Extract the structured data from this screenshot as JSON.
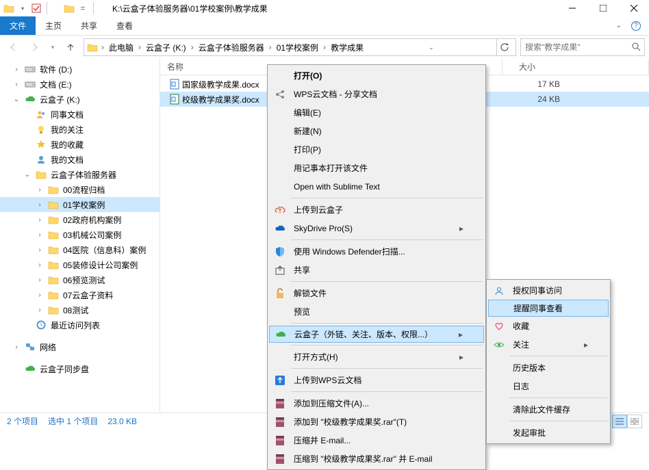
{
  "window": {
    "title": "K:\\云盒子体验服务器\\01学校案例\\教学成果"
  },
  "ribbon": {
    "file": "文件",
    "tabs": [
      "主页",
      "共享",
      "查看"
    ]
  },
  "nav": {
    "crumbs": [
      "此电脑",
      "云盒子 (K:)",
      "云盒子体验服务器",
      "01学校案例",
      "教学成果"
    ],
    "search_placeholder": "搜索\"教学成果\""
  },
  "tree": {
    "top": [
      {
        "label": "软件 (D:)",
        "icon": "drive"
      },
      {
        "label": "文档 (E:)",
        "icon": "drive"
      },
      {
        "label": "云盒子 (K:)",
        "icon": "cloud",
        "open": true
      }
    ],
    "cloud_children": [
      {
        "label": "同事文档",
        "icon": "people"
      },
      {
        "label": "我的关注",
        "icon": "bulb"
      },
      {
        "label": "我的收藏",
        "icon": "star"
      },
      {
        "label": "我的文档",
        "icon": "user"
      },
      {
        "label": "云盒子体验服务器",
        "icon": "folder",
        "open": true
      }
    ],
    "server_children": [
      {
        "label": "00流程归档"
      },
      {
        "label": "01学校案例",
        "sel": true
      },
      {
        "label": "02政府机构案例"
      },
      {
        "label": "03机械公司案例"
      },
      {
        "label": "04医院（信息科）案例"
      },
      {
        "label": "05装修设计公司案例"
      },
      {
        "label": "06预览测试"
      },
      {
        "label": "07云盒子资料"
      },
      {
        "label": "08测试"
      }
    ],
    "recent": "最近访问列表",
    "network": "网络",
    "syncdisk": "云盒子同步盘"
  },
  "columns": {
    "name": "名称",
    "size": "大小"
  },
  "files": [
    {
      "name": "国家级教学成果.docx",
      "size": "17 KB",
      "sel": false,
      "type": "word"
    },
    {
      "name": "校级教学成果奖.docx",
      "size": "24 KB",
      "sel": true,
      "type": "excel"
    }
  ],
  "context_menu": [
    {
      "label": "打开(O)",
      "bold": true
    },
    {
      "label": "WPS云文档 - 分享文档",
      "icon": "share"
    },
    {
      "label": "编辑(E)"
    },
    {
      "label": "新建(N)"
    },
    {
      "label": "打印(P)"
    },
    {
      "label": "用记事本打开该文件"
    },
    {
      "label": "Open with Sublime Text"
    },
    {
      "sep": true
    },
    {
      "label": "上传到云盒子",
      "icon": "upload-cloud"
    },
    {
      "label": "SkyDrive Pro(S)",
      "icon": "skydrive",
      "arrow": true
    },
    {
      "sep": true
    },
    {
      "label": "使用 Windows Defender扫描...",
      "icon": "shield"
    },
    {
      "label": "共享",
      "icon": "share2"
    },
    {
      "sep": true
    },
    {
      "label": "解锁文件",
      "icon": "unlock"
    },
    {
      "label": "预览"
    },
    {
      "sep": true
    },
    {
      "label": "云盒子（外链、关注、版本、权限...）",
      "icon": "cloud",
      "arrow": true,
      "sel": true
    },
    {
      "sep": true
    },
    {
      "label": "打开方式(H)",
      "arrow": true
    },
    {
      "sep": true
    },
    {
      "label": "上传到WPS云文档",
      "icon": "wps"
    },
    {
      "sep": true
    },
    {
      "label": "添加到压缩文件(A)...",
      "icon": "rar"
    },
    {
      "label": "添加到 \"校级教学成果奖.rar\"(T)",
      "icon": "rar"
    },
    {
      "label": "压缩并 E-mail...",
      "icon": "rar"
    },
    {
      "label": "压缩到 \"校级教学成果奖.rar\" 并 E-mail",
      "icon": "rar"
    }
  ],
  "submenu": [
    {
      "label": "授权同事访问",
      "icon": "person"
    },
    {
      "label": "提醒同事查看",
      "sel": true
    },
    {
      "label": "收藏",
      "icon": "heart"
    },
    {
      "label": "关注",
      "icon": "eye",
      "arrow": true
    },
    {
      "sep": true
    },
    {
      "label": "历史版本"
    },
    {
      "label": "日志"
    },
    {
      "sep": true
    },
    {
      "label": "清除此文件缓存"
    },
    {
      "sep": true
    },
    {
      "label": "发起审批"
    }
  ],
  "status": {
    "items": "2 个项目",
    "selected": "选中 1 个项目",
    "size": "23.0 KB"
  }
}
